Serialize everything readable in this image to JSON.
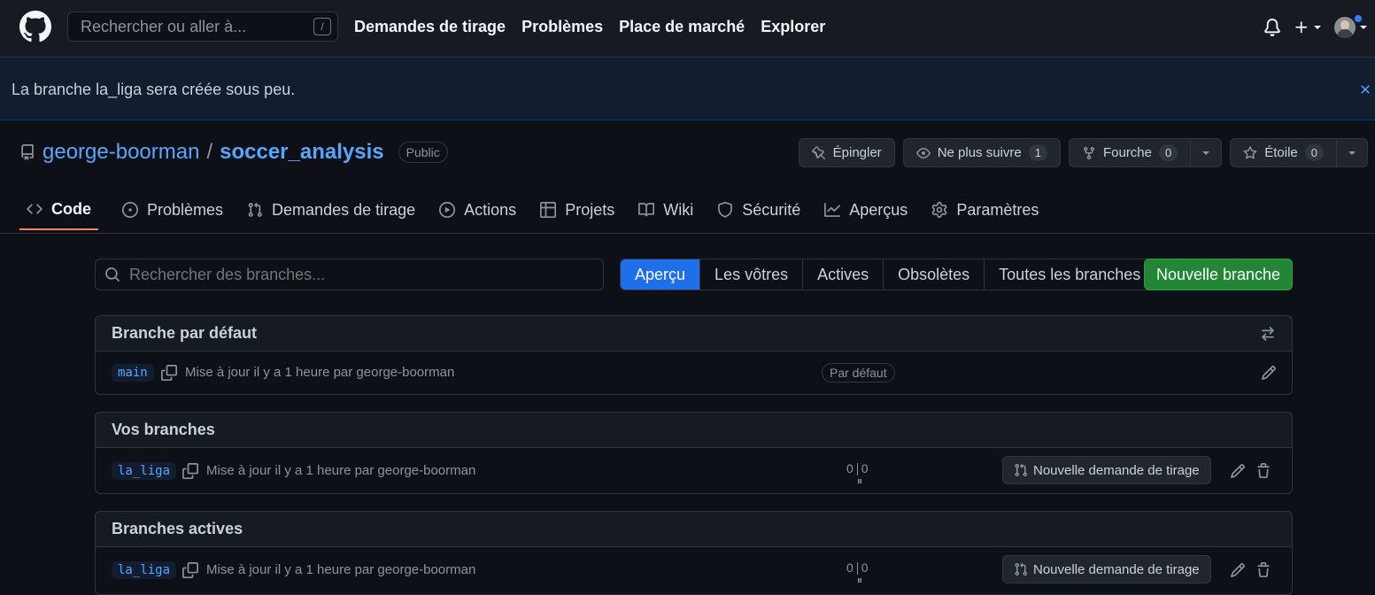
{
  "header": {
    "search_placeholder": "Rechercher ou aller à...",
    "slash_key": "/",
    "nav": [
      "Demandes de tirage",
      "Problèmes",
      "Place de marché",
      "Explorer"
    ]
  },
  "flash": {
    "message": "La branche la_liga sera créée sous peu."
  },
  "repo": {
    "owner": "george-boorman",
    "separator": "/",
    "name": "soccer_analysis",
    "visibility": "Public",
    "actions": {
      "pin": "Épingler",
      "watch": "Ne plus suivre",
      "watch_count": "1",
      "fork": "Fourche",
      "fork_count": "0",
      "star": "Étoile",
      "star_count": "0"
    },
    "tabs": [
      "Code",
      "Problèmes",
      "Demandes de tirage",
      "Actions",
      "Projets",
      "Wiki",
      "Sécurité",
      "Aperçus",
      "Paramètres"
    ]
  },
  "branches": {
    "search_placeholder": "Rechercher des branches...",
    "filters": [
      "Aperçu",
      "Les vôtres",
      "Actives",
      "Obsolètes",
      "Toutes les branches"
    ],
    "active_filter": "Aperçu",
    "new_branch_label": "Nouvelle branche",
    "sections": [
      {
        "title": "Branche par défaut",
        "row": {
          "name": "main",
          "meta": "Mise à jour il y a 1 heure par george-boorman",
          "badge": "Par défaut"
        }
      },
      {
        "title": "Vos branches",
        "row": {
          "name": "la_liga",
          "meta": "Mise à jour il y a 1 heure par george-boorman",
          "behind": "0",
          "ahead": "0",
          "pr_label": "Nouvelle demande de tirage"
        }
      },
      {
        "title": "Branches actives",
        "row": {
          "name": "la_liga",
          "meta": "Mise à jour il y a 1 heure par george-boorman",
          "behind": "0",
          "ahead": "0",
          "pr_label": "Nouvelle demande de tirage"
        }
      }
    ]
  },
  "colors": {
    "accent": "#1f6feb",
    "link": "#58a6ff",
    "success": "#238636",
    "tab_underline": "#f78166"
  }
}
